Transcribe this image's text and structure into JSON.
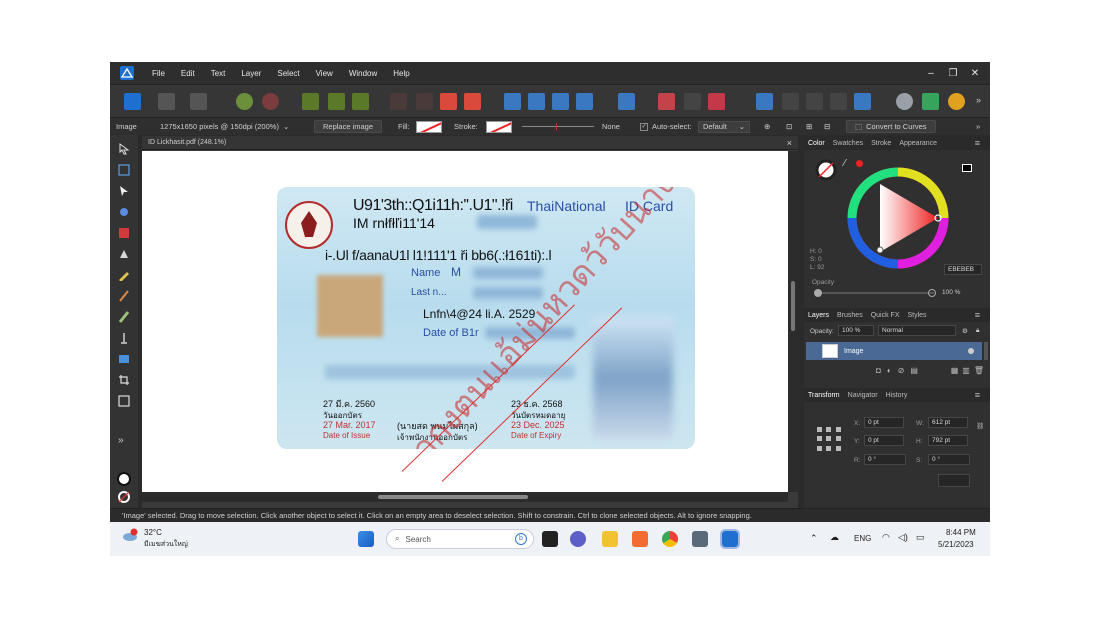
{
  "app": {
    "menu": [
      "File",
      "Edit",
      "Text",
      "Layer",
      "Select",
      "View",
      "Window",
      "Help"
    ],
    "window_controls": [
      "–",
      "❐",
      "✕"
    ]
  },
  "context": {
    "object_type": "Image",
    "image_info": "1275x1650 pixels @ 150dpi (200%)",
    "replace_image": "Replace image",
    "fill_label": "Fill:",
    "stroke_label": "Stroke:",
    "stroke_none": "None",
    "auto_select_label": "Auto-select:",
    "auto_select_value": "Default",
    "convert_to_curves": "Convert to Curves"
  },
  "document": {
    "tab_title": "ID Lickhasit.pdf (248.1%)",
    "card": {
      "line1": "U91'3th::Q1i11h:''.U1\".!ři",
      "line1_en": "ThaiNational",
      "line1_en2": "ID Card",
      "line2": "IM  rnłfłľi11'14",
      "line3": "i-.Ul  f/aanaU1l  l1!111'1 ři      bb6(.:ł161ti):.l",
      "name_label": "Name",
      "name_initial": "M",
      "lastname_label": "Last n...",
      "line_lnfn": "Lnfn\\4@24  li.A.  2529",
      "dob_label": "Date of B1r",
      "issue_th_date": "27 มี.ค. 2560",
      "issue_th_label": "วันออกบัตร",
      "issue_en_date": "27 Mar. 2017",
      "issue_en_label": "Date of Issue",
      "expiry_th_date": "23 ธ.ค. 2568",
      "expiry_th_label": "วันบัตรหมดอายุ",
      "expiry_en_date": "23 Dec. 2025",
      "expiry_en_label": "Date of Expiry",
      "officer_th": "(นายสด  พนมไผสกุล)",
      "officer_label": "เจ้าพนักงานออกบัตร",
      "watermark": "กกงตนเเอ้ม่นหวดว้วับนาง"
    }
  },
  "panels": {
    "color_tabs": [
      "Color",
      "Swatches",
      "Stroke",
      "Appearance"
    ],
    "hsl": {
      "h": "H: 0",
      "s": "S: 0",
      "l": "L: 92"
    },
    "hex": "EBEBEB",
    "opacity_label": "Opacity",
    "opacity_value": "100 %",
    "layers_tabs": [
      "Layers",
      "Brushes",
      "Quick FX",
      "Styles"
    ],
    "layer_opacity_label": "Opacity:",
    "layer_opacity_value": "100 %",
    "blend_mode": "Normal",
    "layer_name": "Image",
    "transform_tabs": [
      "Transform",
      "Navigator",
      "History"
    ],
    "transform": {
      "x_label": "X:",
      "x": "0 pt",
      "y_label": "Y:",
      "y": "0 pt",
      "w_label": "W:",
      "w": "612 pt",
      "h_label": "H:",
      "h": "792 pt",
      "r_label": "R:",
      "r": "0 °",
      "s_label": "S:",
      "s": "0 °"
    }
  },
  "status": {
    "text": "'Image' selected. Drag to move selection. Click another object to select it. Click on an empty area to deselect selection. Shift to constrain. Ctrl to clone selected objects. Alt to ignore snapping."
  },
  "taskbar": {
    "weather_temp": "32°C",
    "weather_desc": "มีเมฆส่วนใหญ่",
    "search_placeholder": "Search",
    "lang": "ENG",
    "time": "8:44 PM",
    "date": "5/21/2023"
  },
  "colors": {
    "accent": "#2f7bd6",
    "layer_selected": "#4a6a95"
  }
}
